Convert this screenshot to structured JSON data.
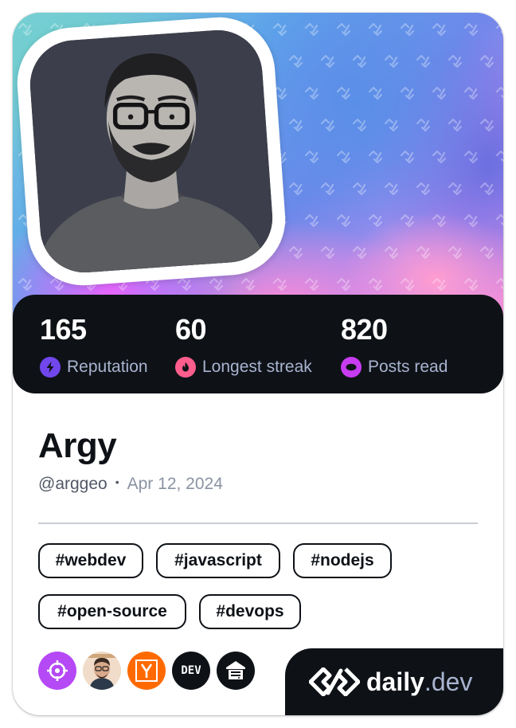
{
  "profile": {
    "name": "Argy",
    "handle": "@arggeo",
    "date": "Apr 12, 2024"
  },
  "stats": [
    {
      "value": "165",
      "label": "Reputation",
      "icon": "lightning-icon",
      "color": "#7147ed"
    },
    {
      "value": "60",
      "label": "Longest streak",
      "icon": "flame-icon",
      "color": "#ff5e8d"
    },
    {
      "value": "820",
      "label": "Posts read",
      "icon": "eye-icon",
      "color": "#c73cf0"
    }
  ],
  "tags": [
    "#webdev",
    "#javascript",
    "#nodejs",
    "#open-source",
    "#devops"
  ],
  "squads": [
    {
      "icon": "crosshair-icon",
      "color": "#b549f5"
    },
    {
      "icon": "avatar-memoji-icon",
      "color": "#efc9a4"
    },
    {
      "icon": "ycombinator-icon",
      "color": "#ff6a00"
    },
    {
      "icon": "dev-logo-icon",
      "color": "#0e1217",
      "text": "DEV"
    },
    {
      "icon": "server-icon",
      "color": "#0e1217"
    }
  ],
  "brand": {
    "name_primary": "daily",
    "name_secondary": ".dev",
    "icon": "daily-dev-logo-icon"
  },
  "colors": {
    "card_dark": "#0e1217",
    "stat_label": "#a8b3cf",
    "text_secondary": "#525866"
  }
}
